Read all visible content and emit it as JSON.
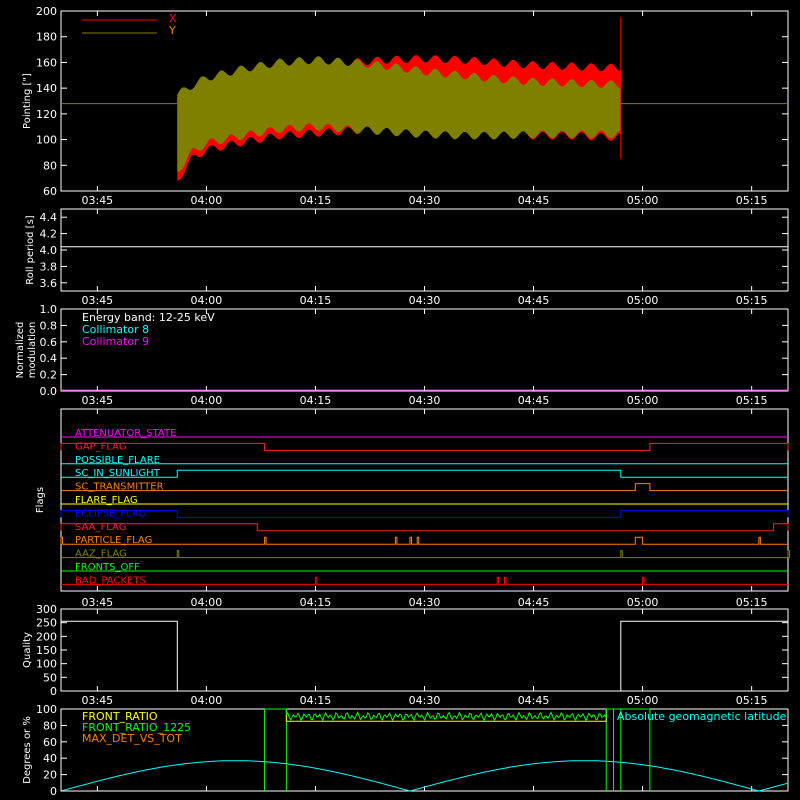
{
  "figure": {
    "x_ticks": [
      "03:45",
      "04:00",
      "04:15",
      "04:30",
      "04:45",
      "05:00",
      "05:15"
    ]
  },
  "colors": {
    "background": "#000000",
    "axes": "#ffffff",
    "x_series": "#ff0000",
    "y_series": "#808000",
    "cyan": "#00ffff",
    "magenta": "#ff00ff",
    "green": "#00ff00",
    "yellow": "#ffff00",
    "orange": "#ff8000",
    "blue": "#0000ff"
  },
  "chart_data": [
    {
      "id": "pointing",
      "type": "line",
      "title": "",
      "ylabel": "Pointing [\"]",
      "xlabel": "",
      "ylim": [
        60,
        200
      ],
      "y_ticks": [
        "60",
        "80",
        "100",
        "120",
        "140",
        "160",
        "180",
        "200"
      ],
      "x_ticks": [
        "03:45",
        "04:00",
        "04:15",
        "04:30",
        "04:45",
        "05:00",
        "05:15"
      ],
      "legend_position": "top-left",
      "series": [
        {
          "name": "X",
          "color": "#ff0000",
          "x": [
            "03:55",
            "03:56",
            "03:58",
            "04:00",
            "04:05",
            "04:10",
            "04:15",
            "04:20",
            "04:25",
            "04:30",
            "04:35",
            "04:40",
            "04:45",
            "04:50",
            "04:55",
            "04:57"
          ],
          "upper": [
            150,
            132,
            142,
            145,
            150,
            155,
            158,
            160,
            162,
            163,
            162,
            160,
            158,
            157,
            156,
            156
          ],
          "lower": [
            130,
            68,
            85,
            92,
            98,
            103,
            105,
            107,
            108,
            107,
            106,
            104,
            103,
            103,
            102,
            102
          ]
        },
        {
          "name": "Y",
          "color": "#808000",
          "x": [
            "03:55",
            "03:56",
            "03:58",
            "04:00",
            "04:05",
            "04:10",
            "04:15",
            "04:20",
            "04:25",
            "04:30",
            "04:35",
            "04:40",
            "04:45",
            "04:50",
            "04:55",
            "04:57"
          ],
          "upper": [
            150,
            135,
            142,
            148,
            155,
            160,
            162,
            160,
            157,
            153,
            150,
            147,
            145,
            144,
            143,
            143
          ],
          "lower": [
            120,
            75,
            90,
            97,
            103,
            108,
            110,
            108,
            106,
            104,
            103,
            103,
            104,
            104,
            104,
            104
          ]
        }
      ],
      "baseline": {
        "value": 128,
        "note": "constant outside data interval"
      },
      "spike": {
        "x": "04:57",
        "min": 85,
        "max": 195
      }
    },
    {
      "id": "roll_period",
      "type": "line",
      "title": "",
      "ylabel": "Roll period [s]",
      "ylim": [
        3.5,
        4.5
      ],
      "y_ticks": [
        "3.6",
        "3.8",
        "4.0",
        "4.2",
        "4.4"
      ],
      "x_ticks": [
        "03:45",
        "04:00",
        "04:15",
        "04:30",
        "04:45",
        "05:00",
        "05:15"
      ],
      "series": [
        {
          "name": "",
          "color": "#ffffff",
          "values": [
            4.04,
            4.04
          ]
        }
      ]
    },
    {
      "id": "modulation",
      "type": "line",
      "title": "",
      "ylabel": "Normalized modulation",
      "ylabel_lines": [
        "Normalized",
        "modulation"
      ],
      "ylim": [
        0,
        1
      ],
      "y_ticks": [
        "0.0",
        "0.2",
        "0.4",
        "0.6",
        "0.8",
        "1.0"
      ],
      "x_ticks": [
        "03:45",
        "04:00",
        "04:15",
        "04:30",
        "04:45",
        "05:00",
        "05:15"
      ],
      "annotations": {
        "energy": "Energy band: 12-25 keV",
        "coll8": "Collimator 8",
        "coll9": "Collimator 9"
      },
      "series": [
        {
          "name": "Collimator 9",
          "color": "#ff00ff",
          "values": [
            0,
            0
          ]
        }
      ]
    },
    {
      "id": "flags",
      "type": "line",
      "title": "",
      "ylabel": "Flags",
      "x_ticks": [
        "03:45",
        "04:00",
        "04:15",
        "04:30",
        "04:45",
        "05:00",
        "05:15"
      ],
      "flags": [
        {
          "name": "ATTENUATOR_STATE",
          "color": "#ff00ff",
          "on": []
        },
        {
          "name": "GAP_FLAG",
          "color": "#ff2020",
          "on": [
            [
              "03:40",
              "04:08"
            ],
            [
              "05:01",
              "05:20"
            ]
          ]
        },
        {
          "name": "POSSIBLE_FLARE",
          "color": "#00ffff",
          "on": []
        },
        {
          "name": "SC_IN_SUNLIGHT",
          "color": "#00ffff",
          "on": [
            [
              "03:56",
              "04:57"
            ]
          ]
        },
        {
          "name": "SC_TRANSMITTER",
          "color": "#ff8000",
          "on": [
            [
              "04:59",
              "05:01"
            ]
          ]
        },
        {
          "name": "FLARE_FLAG",
          "color": "#ffff00",
          "on": []
        },
        {
          "name": "ECLIPSE_FLAG",
          "color": "#0000ff",
          "on": [
            [
              "03:40",
              "03:56"
            ],
            [
              "04:57",
              "05:20"
            ]
          ]
        },
        {
          "name": "SAA_FLAG",
          "color": "#ff2020",
          "on": [
            [
              "03:40",
              "04:07"
            ],
            [
              "05:18",
              "05:20"
            ]
          ]
        },
        {
          "name": "PARTICLE_FLAG",
          "color": "#ff8000",
          "on": [
            [
              "03:40",
              "03:40"
            ],
            [
              "04:08",
              "04:08"
            ],
            [
              "04:26",
              "04:26"
            ],
            [
              "04:28",
              "04:28"
            ],
            [
              "04:29",
              "04:29"
            ],
            [
              "04:59",
              "05:00"
            ],
            [
              "05:16",
              "05:16"
            ]
          ]
        },
        {
          "name": "AAZ_FLAG",
          "color": "#808000",
          "on": [
            [
              "03:56",
              "03:56"
            ],
            [
              "04:57",
              "04:57"
            ],
            [
              "05:20",
              "05:20"
            ]
          ]
        },
        {
          "name": "FRONTS_OFF",
          "color": "#00ff00",
          "on": []
        },
        {
          "name": "BAD_PACKETS",
          "color": "#ff0000",
          "on": [
            [
              "04:15",
              "04:15"
            ],
            [
              "04:40",
              "04:40"
            ],
            [
              "04:41",
              "04:41"
            ],
            [
              "05:00",
              "05:00"
            ]
          ]
        }
      ]
    },
    {
      "id": "quality",
      "type": "line",
      "title": "",
      "ylabel": "Quality",
      "ylim": [
        0,
        300
      ],
      "y_ticks": [
        "0",
        "50",
        "100",
        "150",
        "200",
        "250",
        "300"
      ],
      "x_ticks": [
        "03:45",
        "04:00",
        "04:15",
        "04:30",
        "04:45",
        "05:00",
        "05:15"
      ],
      "series": [
        {
          "name": "",
          "color": "#ffffff",
          "x": [
            "03:40",
            "03:56",
            "03:56",
            "04:57",
            "04:57",
            "05:20"
          ],
          "values": [
            255,
            255,
            0,
            0,
            255,
            255
          ]
        }
      ]
    },
    {
      "id": "ratios",
      "type": "line",
      "title": "",
      "ylabel": "Degrees or %",
      "ylim": [
        0,
        100
      ],
      "y_ticks": [
        "0",
        "20",
        "40",
        "60",
        "80",
        "100"
      ],
      "legend": [
        "FRONT_RATIO",
        "FRONT_RATIO_1225",
        "MAX_DET_VS_TOT"
      ],
      "annotation": "Absolute geomagnetic latitude",
      "series": [
        {
          "name": "FRONT_RATIO",
          "color": "#ffff00",
          "x": [
            "04:08",
            "04:11",
            "04:11",
            "04:55",
            "04:55",
            "04:57"
          ],
          "values": [
            100,
            100,
            85,
            85,
            100,
            100
          ]
        },
        {
          "name": "FRONT_RATIO_1225",
          "color": "#00ff00",
          "x": [
            "04:08",
            "04:11",
            "04:20",
            "04:30",
            "04:40",
            "04:50",
            "04:55",
            "04:57"
          ],
          "values": [
            100,
            100,
            92,
            93,
            91,
            92,
            100,
            100
          ]
        },
        {
          "name": "Absolute geomagnetic latitude",
          "color": "#00ffff",
          "x": [
            "03:40",
            "04:04",
            "04:28",
            "04:52",
            "05:15",
            "05:20"
          ],
          "values": [
            0,
            37,
            0,
            37,
            0,
            10
          ]
        }
      ]
    }
  ]
}
